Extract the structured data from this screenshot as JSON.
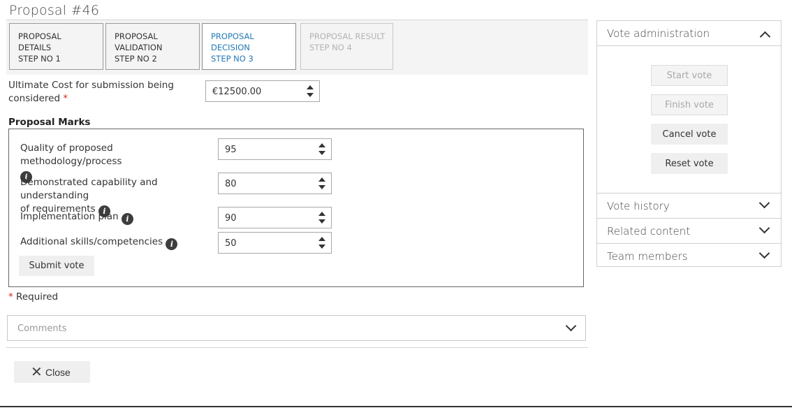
{
  "page": {
    "title": "Proposal #46"
  },
  "steps": [
    {
      "lines": [
        "PROPOSAL",
        "DETAILS",
        "STEP NO 1"
      ],
      "state": "normal"
    },
    {
      "lines": [
        "PROPOSAL",
        "VALIDATION",
        "STEP NO 2"
      ],
      "state": "normal"
    },
    {
      "lines": [
        "PROPOSAL",
        "DECISION",
        "STEP NO 3"
      ],
      "state": "active"
    },
    {
      "lines": [
        "PROPOSAL RESULT",
        "STEP NO 4"
      ],
      "state": "disabled"
    }
  ],
  "cost": {
    "label_line1": "Ultimate Cost for submission being",
    "label_line2": "considered",
    "required_mark": "*",
    "value": "€12500.00"
  },
  "marks": {
    "heading": "Proposal Marks",
    "items": [
      {
        "label_line1": "Quality of proposed methodology/process",
        "label_line2": "",
        "value": "95"
      },
      {
        "label_line1": "Demonstrated capability and understanding",
        "label_line2": "of requirements",
        "value": "80"
      },
      {
        "label_line1": "Implementation plan",
        "label_line2": "",
        "value": "90"
      },
      {
        "label_line1": "Additional skills/competencies",
        "label_line2": "",
        "value": "50"
      }
    ],
    "submit_label": "Submit vote"
  },
  "required_note": {
    "mark": "*",
    "text": "Required"
  },
  "comments": {
    "label": "Comments"
  },
  "close": {
    "label": "Close",
    "icon": "close-icon"
  },
  "vote_admin": {
    "title": "Vote administration",
    "buttons": [
      {
        "label": "Start vote",
        "enabled": false
      },
      {
        "label": "Finish vote",
        "enabled": false
      },
      {
        "label": "Cancel vote",
        "enabled": true
      },
      {
        "label": "Reset vote",
        "enabled": true
      }
    ]
  },
  "side_sections": [
    {
      "label": "Vote history"
    },
    {
      "label": "Related content"
    },
    {
      "label": "Team members"
    }
  ],
  "colors": {
    "active_step": "#2479b5",
    "required": "#d9261c",
    "panel_bg": "#f4f4f4",
    "button_bg": "#efefef"
  }
}
